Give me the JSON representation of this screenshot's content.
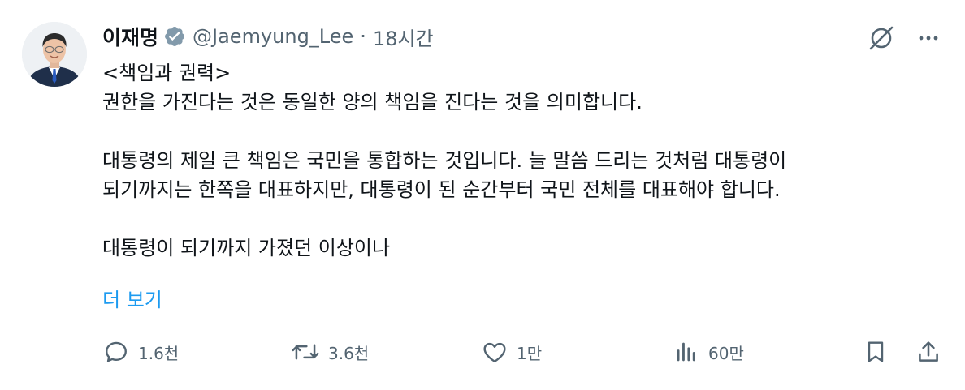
{
  "tweet": {
    "display_name": "이재명",
    "handle": "@Jaemyung_Lee",
    "separator": "·",
    "time": "18시간",
    "body": "<책임과 권력>\n권한을 가진다는 것은 동일한 양의 책임을 진다는 것을 의미합니다.\n\n대통령의 제일 큰 책임은 국민을 통합하는 것입니다. 늘 말씀 드리는 것처럼 대통령이\n되기까지는 한쪽을 대표하지만, 대통령이 된 순간부터 국민 전체를 대표해야 합니다.\n\n대통령이 되기까지 가졌던 이상이나",
    "show_more": "더 보기"
  },
  "actions": {
    "reply_count": "1.6천",
    "retweet_count": "3.6천",
    "like_count": "1만",
    "view_count": "60만"
  },
  "colors": {
    "text": "#0f1419",
    "secondary": "#536471",
    "link": "#1d9bf0",
    "verified_badge": "#829aab"
  },
  "icons": [
    "verified-badge-icon",
    "grok-icon",
    "more-icon",
    "reply-icon",
    "retweet-icon",
    "like-icon",
    "views-icon",
    "bookmark-icon",
    "share-icon"
  ]
}
